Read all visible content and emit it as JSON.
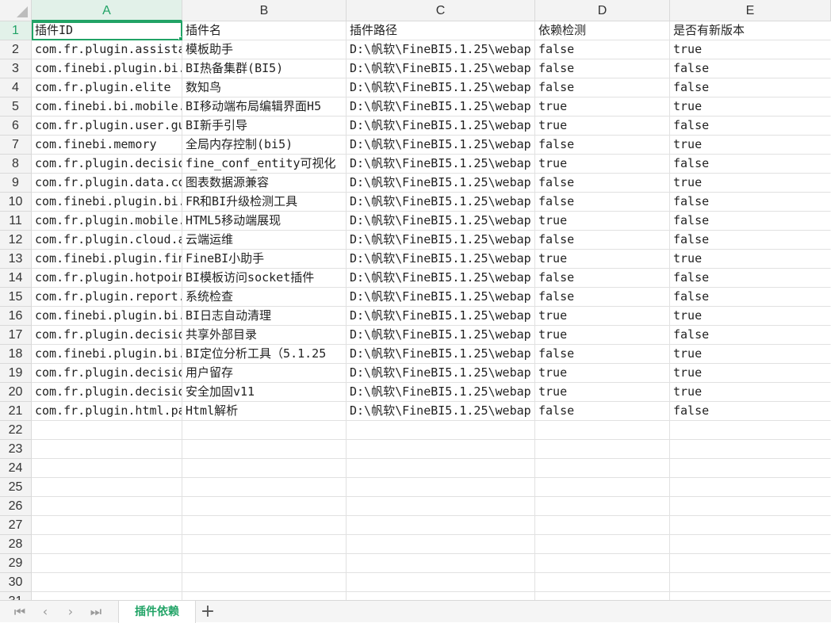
{
  "columns": [
    "A",
    "B",
    "C",
    "D",
    "E"
  ],
  "row_numbers": [
    "1",
    "2",
    "3",
    "4",
    "5",
    "6",
    "7",
    "8",
    "9",
    "10",
    "11",
    "12",
    "13",
    "14",
    "15",
    "16",
    "17",
    "18",
    "19",
    "20",
    "21",
    "22",
    "23",
    "24",
    "25",
    "26",
    "27",
    "28",
    "29",
    "30",
    "31"
  ],
  "active_cell": "A1",
  "rows": [
    [
      "插件ID",
      "插件名",
      "插件路径",
      "依赖检测",
      "是否有新版本"
    ],
    [
      "com.fr.plugin.assista",
      "模板助手",
      "D:\\帆软\\FineBI5.1.25\\webap",
      "false",
      "true"
    ],
    [
      "com.finebi.plugin.bi.",
      "BI热备集群(BI5)",
      "D:\\帆软\\FineBI5.1.25\\webap",
      "false",
      "false"
    ],
    [
      "com.fr.plugin.elite",
      "数知鸟",
      "D:\\帆软\\FineBI5.1.25\\webap",
      "false",
      "false"
    ],
    [
      "com.finebi.bi.mobile.",
      "BI移动端布局编辑界面H5",
      "D:\\帆软\\FineBI5.1.25\\webap",
      "true",
      "true"
    ],
    [
      "com.fr.plugin.user.gu",
      "BI新手引导",
      "D:\\帆软\\FineBI5.1.25\\webap",
      "true",
      "false"
    ],
    [
      "com.finebi.memory",
      "全局内存控制(bi5)",
      "D:\\帆软\\FineBI5.1.25\\webap",
      "false",
      "true"
    ],
    [
      "com.fr.plugin.decisio",
      "fine_conf_entity可视化",
      "D:\\帆软\\FineBI5.1.25\\webap",
      "true",
      "false"
    ],
    [
      "com.fr.plugin.data.co",
      "图表数据源兼容",
      "D:\\帆软\\FineBI5.1.25\\webap",
      "false",
      "true"
    ],
    [
      "com.finebi.plugin.bi.",
      "FR和BI升级检测工具",
      "D:\\帆软\\FineBI5.1.25\\webap",
      "false",
      "false"
    ],
    [
      "com.fr.plugin.mobile.",
      "HTML5移动端展现",
      "D:\\帆软\\FineBI5.1.25\\webap",
      "true",
      "false"
    ],
    [
      "com.fr.plugin.cloud.a",
      "云端运维",
      "D:\\帆软\\FineBI5.1.25\\webap",
      "false",
      "false"
    ],
    [
      "com.finebi.plugin.fin",
      "FineBI小助手",
      "D:\\帆软\\FineBI5.1.25\\webap",
      "true",
      "true"
    ],
    [
      "com.fr.plugin.hotpoin",
      "BI模板访问socket插件",
      "D:\\帆软\\FineBI5.1.25\\webap",
      "false",
      "false"
    ],
    [
      "com.fr.plugin.report.",
      "系统检查",
      "D:\\帆软\\FineBI5.1.25\\webap",
      "false",
      "false"
    ],
    [
      "com.finebi.plugin.bi.",
      "BI日志自动清理",
      "D:\\帆软\\FineBI5.1.25\\webap",
      "true",
      "true"
    ],
    [
      "com.fr.plugin.decisio",
      "共享外部目录",
      "D:\\帆软\\FineBI5.1.25\\webap",
      "true",
      "false"
    ],
    [
      "com.finebi.plugin.bi.",
      "BI定位分析工具（5.1.25",
      "D:\\帆软\\FineBI5.1.25\\webap",
      "false",
      "true"
    ],
    [
      "com.fr.plugin.decisio",
      "用户留存",
      "D:\\帆软\\FineBI5.1.25\\webap",
      "true",
      "true"
    ],
    [
      "com.fr.plugin.decisio",
      "安全加固v11",
      "D:\\帆软\\FineBI5.1.25\\webap",
      "true",
      "true"
    ],
    [
      "com.fr.plugin.html.pa",
      "Html解析",
      "D:\\帆软\\FineBI5.1.25\\webap",
      "false",
      "false"
    ]
  ],
  "sheet_tabs": [
    "插件依赖"
  ],
  "nav": {
    "first": "⏮",
    "prev": "‹",
    "next": "›",
    "last": "⏭",
    "add": "+"
  },
  "colors": {
    "accent": "#21a366",
    "header_bg": "#f3f3f3",
    "grid_line": "#e1e1e1"
  }
}
